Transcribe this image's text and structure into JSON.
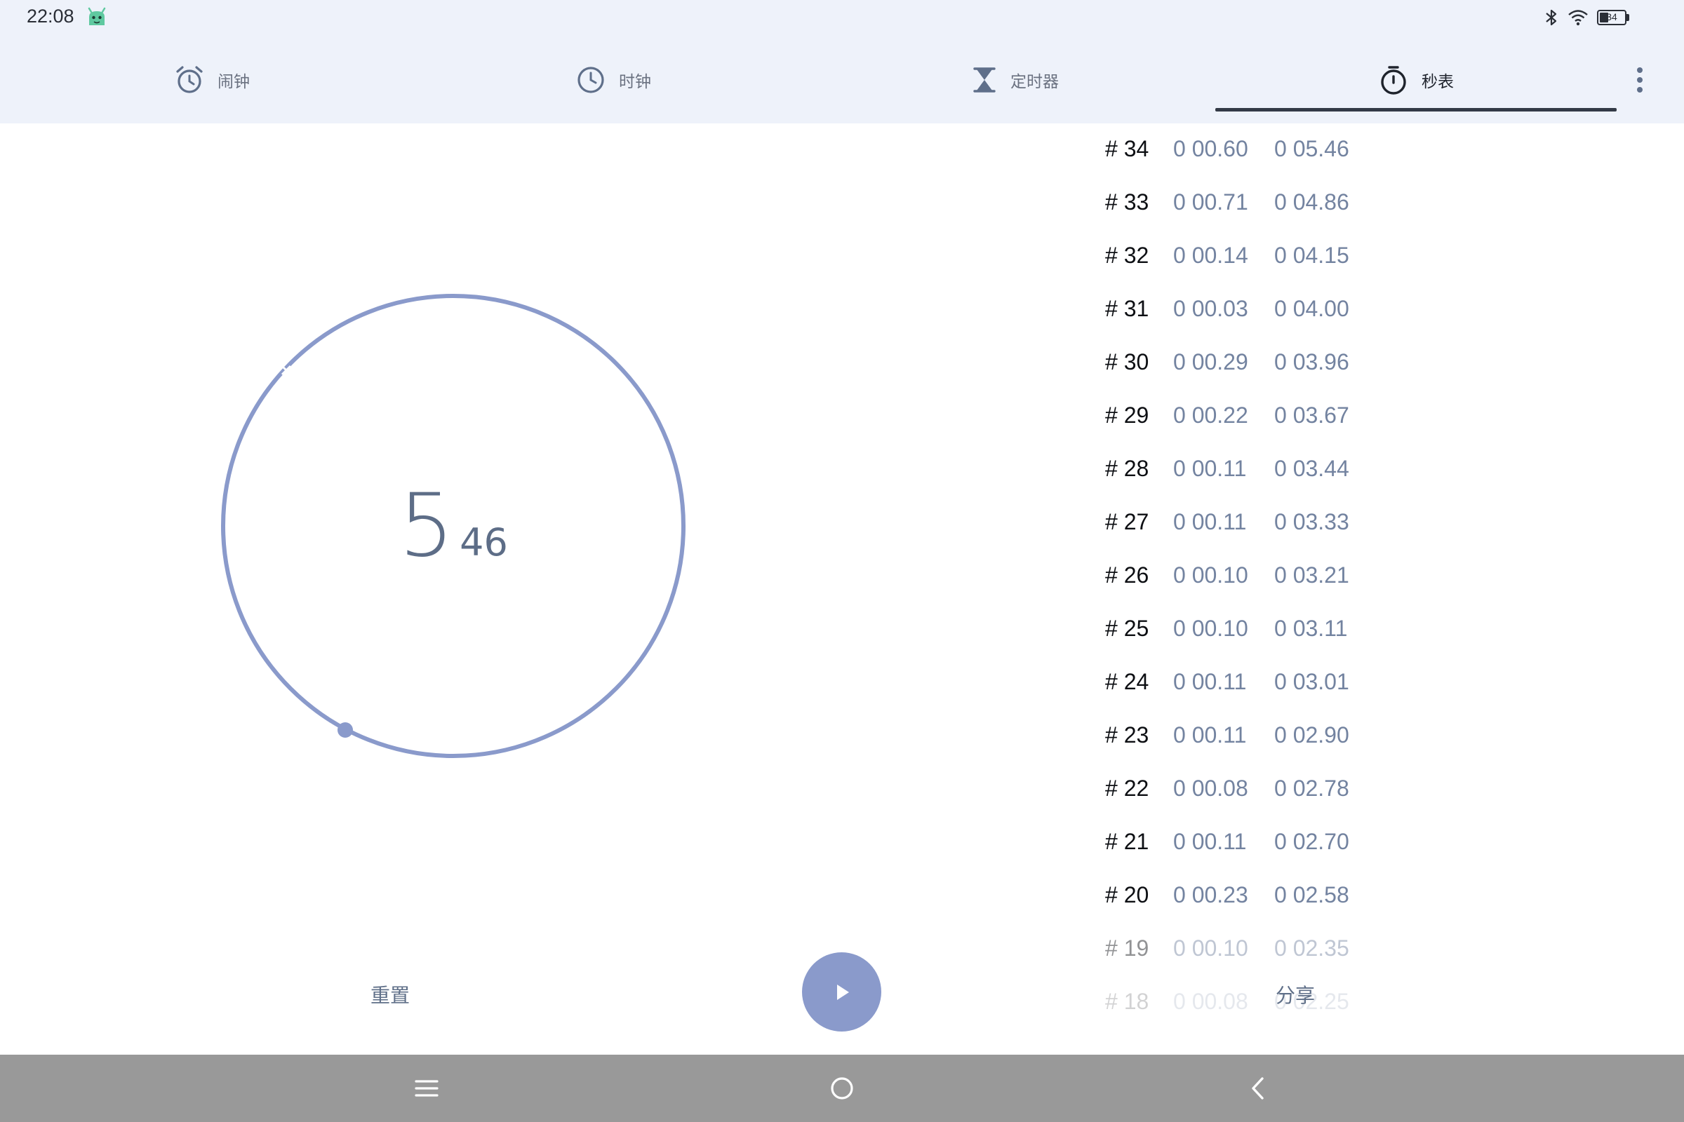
{
  "status_bar": {
    "time": "22:08",
    "app_icon": "android-robot-icon",
    "battery_level": "34",
    "icons": [
      "bluetooth-icon",
      "wifi-icon",
      "battery-icon"
    ]
  },
  "tabs": [
    {
      "label": "闹钟",
      "icon": "alarm-clock-icon",
      "active": false
    },
    {
      "label": "时钟",
      "icon": "clock-icon",
      "active": false
    },
    {
      "label": "定时器",
      "icon": "hourglass-icon",
      "active": false
    },
    {
      "label": "秒表",
      "icon": "stopwatch-icon",
      "active": true
    }
  ],
  "stopwatch": {
    "seconds": "5",
    "hundredths": "46"
  },
  "laps": [
    {
      "num": "# 34",
      "lap": "0 00.60",
      "total": "0 05.46"
    },
    {
      "num": "# 33",
      "lap": "0 00.71",
      "total": "0 04.86"
    },
    {
      "num": "# 32",
      "lap": "0 00.14",
      "total": "0 04.15"
    },
    {
      "num": "# 31",
      "lap": "0 00.03",
      "total": "0 04.00"
    },
    {
      "num": "# 30",
      "lap": "0 00.29",
      "total": "0 03.96"
    },
    {
      "num": "# 29",
      "lap": "0 00.22",
      "total": "0 03.67"
    },
    {
      "num": "# 28",
      "lap": "0 00.11",
      "total": "0 03.44"
    },
    {
      "num": "# 27",
      "lap": "0 00.11",
      "total": "0 03.33"
    },
    {
      "num": "# 26",
      "lap": "0 00.10",
      "total": "0 03.21"
    },
    {
      "num": "# 25",
      "lap": "0 00.10",
      "total": "0 03.11"
    },
    {
      "num": "# 24",
      "lap": "0 00.11",
      "total": "0 03.01"
    },
    {
      "num": "# 23",
      "lap": "0 00.11",
      "total": "0 02.90"
    },
    {
      "num": "# 22",
      "lap": "0 00.08",
      "total": "0 02.78"
    },
    {
      "num": "# 21",
      "lap": "0 00.11",
      "total": "0 02.70"
    },
    {
      "num": "# 20",
      "lap": "0 00.23",
      "total": "0 02.58"
    },
    {
      "num": "# 19",
      "lap": "0 00.10",
      "total": "0 02.35"
    },
    {
      "num": "# 18",
      "lap": "0 00.08",
      "total": "0 02.25"
    }
  ],
  "controls": {
    "reset_label": "重置",
    "play_icon": "play-icon",
    "share_label": "分享"
  },
  "nav": {
    "icons": [
      "menu-icon",
      "home-icon",
      "back-icon"
    ]
  },
  "colors": {
    "accent": "#8a9acb",
    "bar_bg": "#eef2fa",
    "nav_bg": "#999999",
    "lap_text": "#7383a0"
  }
}
